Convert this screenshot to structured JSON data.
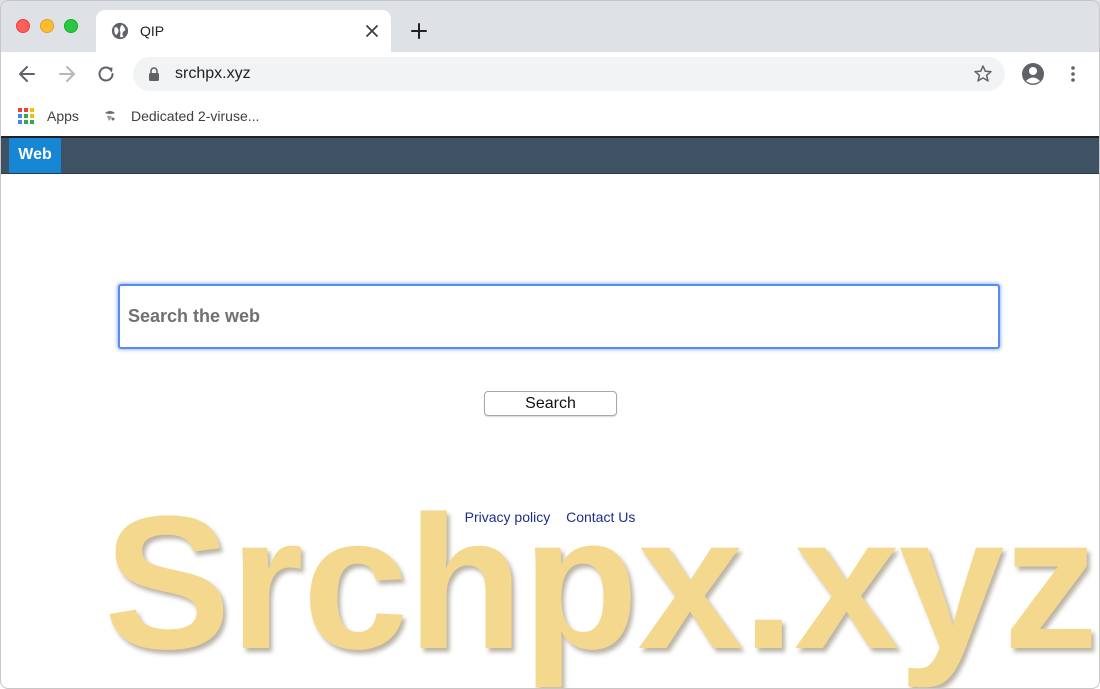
{
  "browser": {
    "tab_title": "QIP",
    "url": "srchpx.xyz",
    "bookmarks": [
      {
        "label": "Apps"
      },
      {
        "label": "Dedicated 2-viruse..."
      }
    ]
  },
  "page": {
    "nav_tab": "Web",
    "search_placeholder": "Search the web",
    "search_button": "Search",
    "footer_links": [
      {
        "label": "Privacy policy"
      },
      {
        "label": "Contact Us"
      }
    ],
    "watermark": "Srchpx.xyz"
  },
  "colors": {
    "navbar": "#3e5264",
    "web_tab": "#1786d5",
    "watermark": "#f3d88e",
    "link": "#1a2f8c"
  }
}
